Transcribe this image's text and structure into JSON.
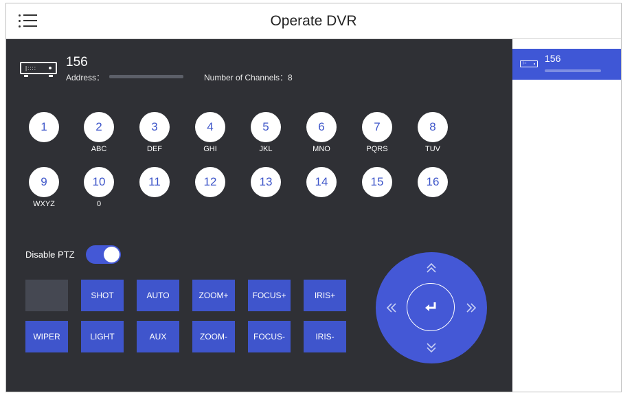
{
  "header": {
    "title": "Operate DVR",
    "menu_icon": "hamburger-menu-icon"
  },
  "device": {
    "icon": "dvr-device-icon",
    "name": "156",
    "address_label": "Address：",
    "channels_text": "Number of Channels：8"
  },
  "keypad": {
    "keys": [
      {
        "num": "1",
        "sub": ""
      },
      {
        "num": "2",
        "sub": "ABC"
      },
      {
        "num": "3",
        "sub": "DEF"
      },
      {
        "num": "4",
        "sub": "GHI"
      },
      {
        "num": "5",
        "sub": "JKL"
      },
      {
        "num": "6",
        "sub": "MNO"
      },
      {
        "num": "7",
        "sub": "PQRS"
      },
      {
        "num": "8",
        "sub": "TUV"
      },
      {
        "num": "9",
        "sub": "WXYZ"
      },
      {
        "num": "10",
        "sub": "0"
      },
      {
        "num": "11",
        "sub": ""
      },
      {
        "num": "12",
        "sub": ""
      },
      {
        "num": "13",
        "sub": ""
      },
      {
        "num": "14",
        "sub": ""
      },
      {
        "num": "15",
        "sub": ""
      },
      {
        "num": "16",
        "sub": ""
      }
    ]
  },
  "ptz": {
    "disable_label": "Disable PTZ",
    "disable_enabled": true,
    "buttons_row1": [
      "SHOT",
      "AUTO",
      "ZOOM+",
      "FOCUS+",
      "IRIS+"
    ],
    "buttons_row2": [
      "WIPER",
      "LIGHT",
      "AUX",
      "ZOOM-",
      "FOCUS-",
      "IRIS-"
    ]
  },
  "dpad": {
    "up_icon": "double-chevron-up-icon",
    "down_icon": "double-chevron-down-icon",
    "left_icon": "double-chevron-left-icon",
    "right_icon": "double-chevron-right-icon",
    "center_icon": "enter-icon"
  },
  "sidebar": {
    "items": [
      {
        "name": "156",
        "icon": "dvr-device-icon"
      }
    ]
  },
  "colors": {
    "accent": "#3f55cc",
    "panel_bg": "#2f3035",
    "key_bg": "#ffffff",
    "key_text": "#3d55c9"
  }
}
